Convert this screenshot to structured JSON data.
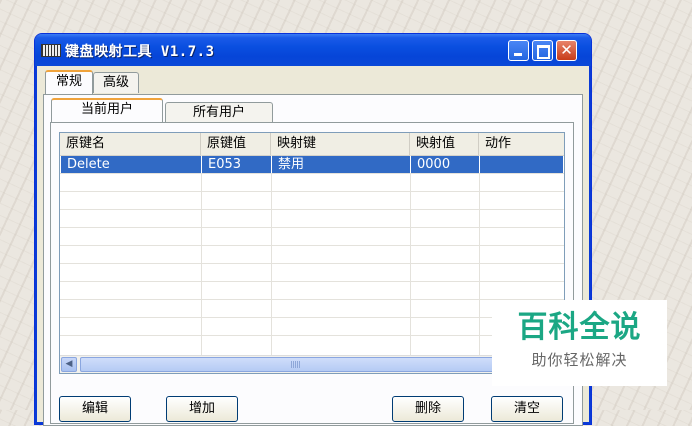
{
  "window": {
    "title": "键盘映射工具 V1.7.3"
  },
  "tabs": [
    {
      "label": "常规",
      "active": true
    },
    {
      "label": "高级",
      "active": false
    }
  ],
  "subtabs": [
    {
      "label": "当前用户",
      "active": true
    },
    {
      "label": "所有用户",
      "active": false
    }
  ],
  "list": {
    "columns": [
      "原键名",
      "原键值",
      "映射键",
      "映射值",
      "动作"
    ],
    "rows": [
      {
        "cells": [
          "Delete",
          "E053",
          "禁用",
          "0000",
          ""
        ],
        "selected": true
      }
    ],
    "scroll_grip": "III"
  },
  "buttons": {
    "edit": "编辑",
    "add": "增加",
    "delete": "删除",
    "clear": "清空"
  },
  "watermark": {
    "main": "百科全说",
    "sub": "助你轻松解决"
  },
  "colors": {
    "titlebar": "#0a4fe0",
    "selection": "#316ac5",
    "close_button": "#c83c1a",
    "watermark": "#1ba784"
  }
}
